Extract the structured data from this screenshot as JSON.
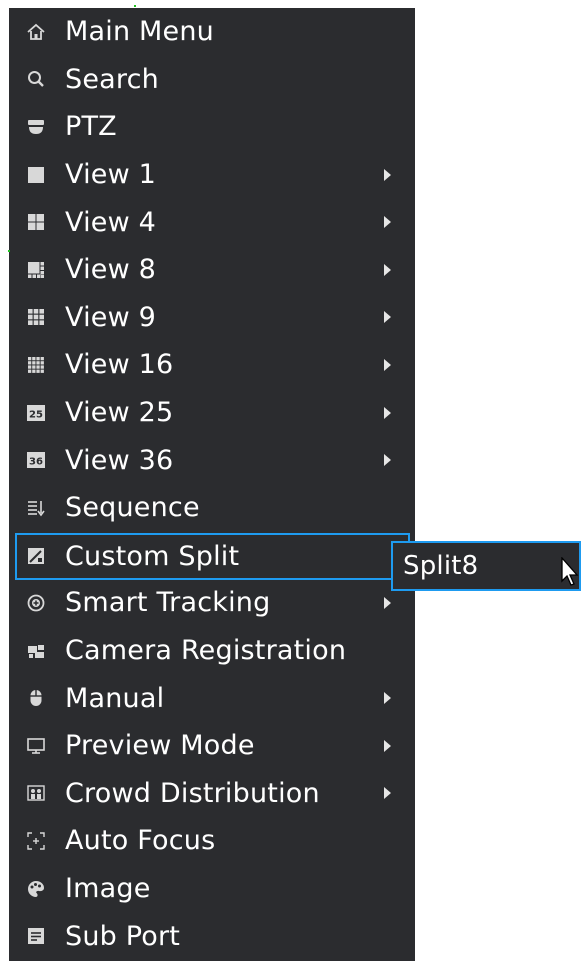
{
  "menu": {
    "items": [
      {
        "label": "Main Menu",
        "icon": "home-icon",
        "submenu": false
      },
      {
        "label": "Search",
        "icon": "search-icon",
        "submenu": false
      },
      {
        "label": "PTZ",
        "icon": "ptz-camera-icon",
        "submenu": false
      },
      {
        "label": "View 1",
        "icon": "single-view-icon",
        "submenu": true
      },
      {
        "label": "View 4",
        "icon": "quad-view-icon",
        "submenu": true
      },
      {
        "label": "View 8",
        "icon": "eight-view-icon",
        "submenu": true
      },
      {
        "label": "View 9",
        "icon": "nine-view-icon",
        "submenu": true
      },
      {
        "label": "View 16",
        "icon": "sixteen-view-icon",
        "submenu": true
      },
      {
        "label": "View 25",
        "icon": "view-25-icon",
        "icon_text": "25",
        "submenu": true
      },
      {
        "label": "View 36",
        "icon": "view-36-icon",
        "icon_text": "36",
        "submenu": true
      },
      {
        "label": "Sequence",
        "icon": "sequence-icon",
        "submenu": false
      },
      {
        "label": "Custom Split",
        "icon": "custom-split-icon",
        "submenu": false,
        "selected": true
      },
      {
        "label": "Smart Tracking",
        "icon": "smart-tracking-icon",
        "submenu": true
      },
      {
        "label": "Camera Registration",
        "icon": "camera-registration-icon",
        "submenu": false
      },
      {
        "label": "Manual",
        "icon": "mouse-icon",
        "submenu": true
      },
      {
        "label": "Preview Mode",
        "icon": "monitor-icon",
        "submenu": true
      },
      {
        "label": "Crowd Distribution",
        "icon": "crowd-distribution-icon",
        "submenu": true
      },
      {
        "label": "Auto Focus",
        "icon": "auto-focus-icon",
        "submenu": false
      },
      {
        "label": "Image",
        "icon": "image-palette-icon",
        "submenu": false
      },
      {
        "label": "Sub Port",
        "icon": "sub-port-icon",
        "submenu": false
      }
    ]
  },
  "submenu": {
    "label": "Split8"
  },
  "colors": {
    "menu_bg": "#2b2c2f",
    "highlight": "#1e9bf0",
    "text": "#ffffff"
  }
}
